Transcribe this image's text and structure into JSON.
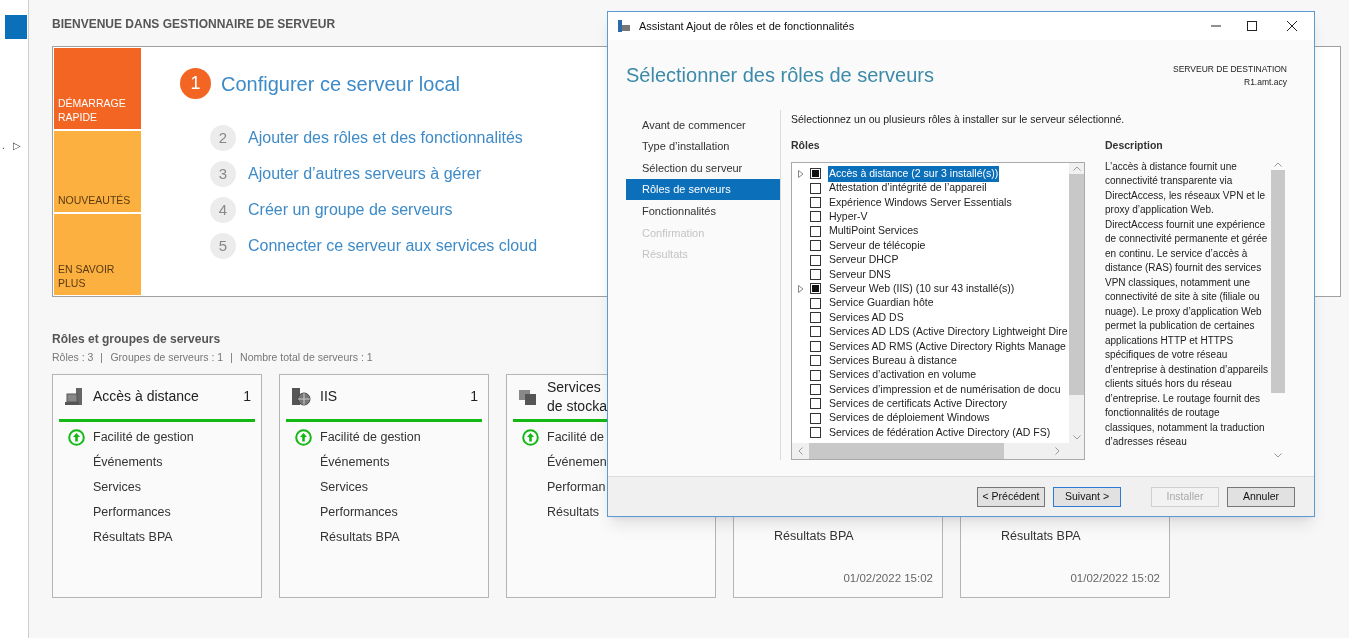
{
  "sidebar": {
    "items": [
      {
        "label": ".",
        "selected": false
      },
      {
        "label": "▷",
        "selected": false
      }
    ]
  },
  "welcome": {
    "title": "BIENVENUE DANS GESTIONNAIRE DE SERVEUR",
    "tiles": [
      {
        "label": "DÉMARRAGE RAPIDE",
        "selected": true
      },
      {
        "label": "NOUVEAUTÉS",
        "selected": false
      },
      {
        "label": "EN SAVOIR PLUS",
        "selected": false
      }
    ],
    "steps": [
      {
        "number": "1",
        "label": "Configurer ce serveur local",
        "selected": true
      },
      {
        "number": "2",
        "label": "Ajouter des rôles et des fonctionnalités",
        "selected": false
      },
      {
        "number": "3",
        "label": "Ajouter d’autres serveurs à gérer",
        "selected": false
      },
      {
        "number": "4",
        "label": "Créer un groupe de serveurs",
        "selected": false
      },
      {
        "number": "5",
        "label": "Connecter ce serveur aux services cloud",
        "selected": false
      }
    ]
  },
  "roles_section": {
    "title": "Rôles et groupes de serveurs",
    "stats": [
      "Rôles : 3",
      "Groupes de serveurs : 1",
      "Nombre total de serveurs : 1"
    ],
    "cards": [
      {
        "kind": "remote",
        "title": [
          "Accès à distance"
        ],
        "count": "1",
        "rows": [
          {
            "label": "Facilité de gestion",
            "healthy": true
          },
          {
            "label": "Événements",
            "healthy": false
          },
          {
            "label": "Services",
            "healthy": false
          },
          {
            "label": "Performances",
            "healthy": false
          },
          {
            "label": "Résultats BPA",
            "healthy": false
          }
        ]
      },
      {
        "kind": "iis",
        "title": [
          "IIS"
        ],
        "count": "1",
        "rows": [
          {
            "label": "Facilité de gestion",
            "healthy": true
          },
          {
            "label": "Événements",
            "healthy": false
          },
          {
            "label": "Services",
            "healthy": false
          },
          {
            "label": "Performances",
            "healthy": false
          },
          {
            "label": "Résultats BPA",
            "healthy": false
          }
        ]
      },
      {
        "kind": "storage",
        "title": [
          "Services",
          "de stocka"
        ],
        "rows": [
          {
            "label": "Facilité de",
            "healthy": true
          },
          {
            "label": "Événemen",
            "healthy": false
          },
          {
            "label": "Performan",
            "healthy": false
          },
          {
            "label": "Résultats",
            "healthy": false
          }
        ]
      },
      {
        "kind": "covered",
        "rows": [
          {
            "label": "Résultats BPA",
            "healthy": false
          }
        ],
        "timestamp": "01/02/2022 15:02"
      },
      {
        "kind": "covered",
        "rows": [
          {
            "label": "Résultats BPA",
            "healthy": false
          }
        ],
        "timestamp": "01/02/2022 15:02"
      }
    ]
  },
  "dialog": {
    "title": "Assistant Ajout de rôles et de fonctionnalités",
    "heading": "Sélectionner des rôles de serveurs",
    "destination": {
      "label": "SERVEUR DE DESTINATION",
      "server": "R1.amt.acy"
    },
    "nav": [
      {
        "label": "Avant de commencer",
        "selected": false,
        "disabled": false
      },
      {
        "label": "Type d’installation",
        "selected": false,
        "disabled": false
      },
      {
        "label": "Sélection du serveur",
        "selected": false,
        "disabled": false
      },
      {
        "label": "Rôles de serveurs",
        "selected": true,
        "disabled": false
      },
      {
        "label": "Fonctionnalités",
        "selected": false,
        "disabled": false
      },
      {
        "label": "Confirmation",
        "selected": false,
        "disabled": true
      },
      {
        "label": "Résultats",
        "selected": false,
        "disabled": true
      }
    ],
    "instruction": "Sélectionnez un ou plusieurs rôles à installer sur le serveur sélectionné.",
    "roles_heading": "Rôles",
    "roles": [
      {
        "label": "Accès à distance (2 sur 3 installé(s))",
        "partial": true,
        "expandable": true,
        "selected": true
      },
      {
        "label": "Attestation d’intégrité de l’appareil",
        "partial": false,
        "expandable": false,
        "selected": false
      },
      {
        "label": "Expérience Windows Server Essentials",
        "partial": false,
        "expandable": false,
        "selected": false
      },
      {
        "label": "Hyper-V",
        "partial": false,
        "expandable": false,
        "selected": false
      },
      {
        "label": "MultiPoint Services",
        "partial": false,
        "expandable": false,
        "selected": false
      },
      {
        "label": "Serveur de télécopie",
        "partial": false,
        "expandable": false,
        "selected": false
      },
      {
        "label": "Serveur DHCP",
        "partial": false,
        "expandable": false,
        "selected": false
      },
      {
        "label": "Serveur DNS",
        "partial": false,
        "expandable": false,
        "selected": false
      },
      {
        "label": "Serveur Web (IIS) (10 sur 43 installé(s))",
        "partial": true,
        "expandable": true,
        "selected": false
      },
      {
        "label": "Service Guardian hôte",
        "partial": false,
        "expandable": false,
        "selected": false
      },
      {
        "label": "Services AD DS",
        "partial": false,
        "expandable": false,
        "selected": false
      },
      {
        "label": "Services AD LDS (Active Directory Lightweight Dire",
        "partial": false,
        "expandable": false,
        "selected": false
      },
      {
        "label": "Services AD RMS (Active Directory Rights Manage",
        "partial": false,
        "expandable": false,
        "selected": false
      },
      {
        "label": "Services Bureau à distance",
        "partial": false,
        "expandable": false,
        "selected": false
      },
      {
        "label": "Services d’activation en volume",
        "partial": false,
        "expandable": false,
        "selected": false
      },
      {
        "label": "Services d’impression et de numérisation de docu",
        "partial": false,
        "expandable": false,
        "selected": false
      },
      {
        "label": "Services de certificats Active Directory",
        "partial": false,
        "expandable": false,
        "selected": false
      },
      {
        "label": "Services de déploiement Windows",
        "partial": false,
        "expandable": false,
        "selected": false
      },
      {
        "label": "Services de fédération Active Directory (AD FS)",
        "partial": false,
        "expandable": false,
        "selected": false
      }
    ],
    "description_heading": "Description",
    "description": "L’accès à distance fournit une connectivité transparente via DirectAccess, les réseaux VPN et le proxy d’application Web. DirectAccess fournit une expérience de connectivité permanente et gérée en continu. Le service d’accès à distance (RAS) fournit des services VPN classiques, notamment une connectivité de site à site (filiale ou nuage). Le proxy d’application Web permet la publication de certaines applications HTTP et HTTPS spécifiques de votre réseau d’entreprise à destination d’appareils clients situés hors du réseau d’entreprise. Le routage fournit des fonctionnalités de routage classiques, notamment la traduction d’adresses réseau",
    "buttons": [
      {
        "label": "< Précédent",
        "disabled": false,
        "default": false
      },
      {
        "label": "Suivant >",
        "disabled": false,
        "default": true
      },
      {
        "label": "Installer",
        "disabled": true,
        "default": false
      },
      {
        "label": "Annuler",
        "disabled": false,
        "default": false
      }
    ]
  }
}
